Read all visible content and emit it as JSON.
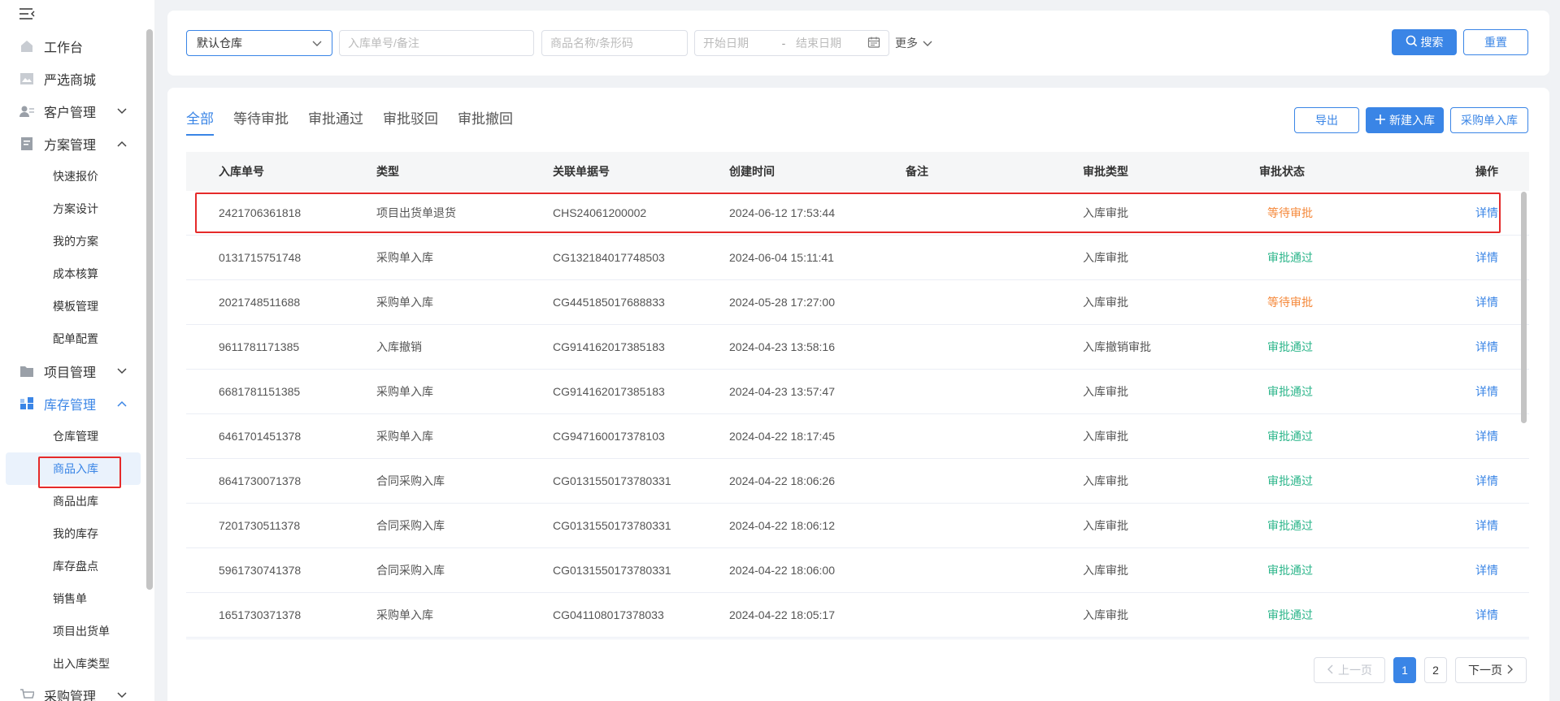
{
  "sidebar": {
    "items": [
      {
        "label": "工作台",
        "icon": "home-icon"
      },
      {
        "label": "严选商城",
        "icon": "image-icon"
      },
      {
        "label": "客户管理",
        "icon": "user-card-icon"
      },
      {
        "label": "方案管理",
        "icon": "document-icon"
      },
      {
        "label": "项目管理",
        "icon": "folder-icon"
      },
      {
        "label": "库存管理",
        "icon": "blocks-icon"
      },
      {
        "label": "采购管理",
        "icon": "cart-icon"
      }
    ],
    "plan_children": [
      "快速报价",
      "方案设计",
      "我的方案",
      "成本核算",
      "模板管理",
      "配单配置"
    ],
    "inventory_children": [
      "仓库管理",
      "商品入库",
      "商品出库",
      "我的库存",
      "库存盘点",
      "销售单",
      "项目出货单",
      "出入库类型"
    ]
  },
  "search": {
    "warehouse_value": "默认仓库",
    "order_placeholder": "入库单号/备注",
    "product_placeholder": "商品名称/条形码",
    "start_date_placeholder": "开始日期",
    "date_separator": "-",
    "end_date_placeholder": "结束日期",
    "more_label": "更多",
    "search_label": "搜索",
    "reset_label": "重置"
  },
  "tabs": [
    "全部",
    "等待审批",
    "审批通过",
    "审批驳回",
    "审批撤回"
  ],
  "actions": {
    "export": "导出",
    "new_inbound": "新建入库",
    "purchase_inbound": "采购单入库"
  },
  "table": {
    "columns": [
      "入库单号",
      "类型",
      "关联单据号",
      "创建时间",
      "备注",
      "审批类型",
      "审批状态",
      "操作"
    ],
    "rows": [
      {
        "id": "2421706361818",
        "type": "项目出货单退货",
        "ref": "CHS24061200002",
        "time": "2024-06-12 17:53:44",
        "note": "",
        "approval_type": "入库审批",
        "status": "等待审批",
        "status_kind": "wait",
        "op": "详情"
      },
      {
        "id": "0131715751748",
        "type": "采购单入库",
        "ref": "CG132184017748503",
        "time": "2024-06-04 15:11:41",
        "note": "",
        "approval_type": "入库审批",
        "status": "审批通过",
        "status_kind": "pass",
        "op": "详情"
      },
      {
        "id": "2021748511688",
        "type": "采购单入库",
        "ref": "CG445185017688833",
        "time": "2024-05-28 17:27:00",
        "note": "",
        "approval_type": "入库审批",
        "status": "等待审批",
        "status_kind": "wait",
        "op": "详情"
      },
      {
        "id": "9611781171385",
        "type": "入库撤销",
        "ref": "CG914162017385183",
        "time": "2024-04-23 13:58:16",
        "note": "",
        "approval_type": "入库撤销审批",
        "status": "审批通过",
        "status_kind": "pass",
        "op": "详情"
      },
      {
        "id": "6681781151385",
        "type": "采购单入库",
        "ref": "CG914162017385183",
        "time": "2024-04-23 13:57:47",
        "note": "",
        "approval_type": "入库审批",
        "status": "审批通过",
        "status_kind": "pass",
        "op": "详情"
      },
      {
        "id": "6461701451378",
        "type": "采购单入库",
        "ref": "CG947160017378103",
        "time": "2024-04-22 18:17:45",
        "note": "",
        "approval_type": "入库审批",
        "status": "审批通过",
        "status_kind": "pass",
        "op": "详情"
      },
      {
        "id": "8641730071378",
        "type": "合同采购入库",
        "ref": "CG0131550173780331",
        "time": "2024-04-22 18:06:26",
        "note": "",
        "approval_type": "入库审批",
        "status": "审批通过",
        "status_kind": "pass",
        "op": "详情"
      },
      {
        "id": "7201730511378",
        "type": "合同采购入库",
        "ref": "CG0131550173780331",
        "time": "2024-04-22 18:06:12",
        "note": "",
        "approval_type": "入库审批",
        "status": "审批通过",
        "status_kind": "pass",
        "op": "详情"
      },
      {
        "id": "5961730741378",
        "type": "合同采购入库",
        "ref": "CG0131550173780331",
        "time": "2024-04-22 18:06:00",
        "note": "",
        "approval_type": "入库审批",
        "status": "审批通过",
        "status_kind": "pass",
        "op": "详情"
      },
      {
        "id": "1651730371378",
        "type": "采购单入库",
        "ref": "CG041108017378033",
        "time": "2024-04-22 18:05:17",
        "note": "",
        "approval_type": "入库审批",
        "status": "审批通过",
        "status_kind": "pass",
        "op": "详情"
      }
    ]
  },
  "pagination": {
    "prev": "上一页",
    "pages": [
      "1",
      "2"
    ],
    "current": "1",
    "next": "下一页"
  },
  "colors": {
    "accent": "#3a85e6",
    "wait": "#f5883a",
    "pass": "#2bb58a",
    "highlight": "#e52a2a"
  }
}
